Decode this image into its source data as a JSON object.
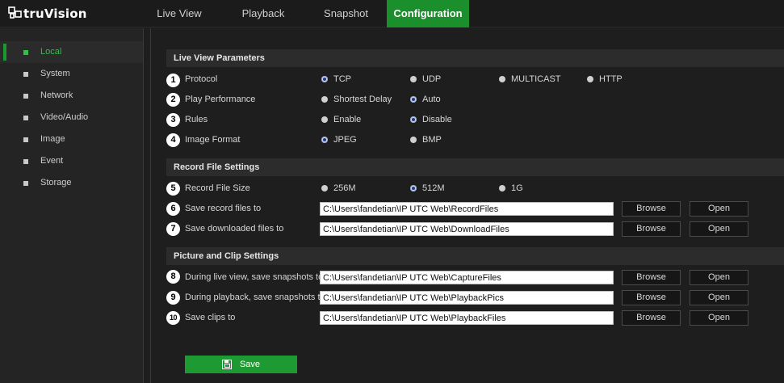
{
  "app": {
    "logo_text": "truVision",
    "logo_icon": "truvision-logo-icon"
  },
  "nav": {
    "tabs": [
      {
        "label": "Live View",
        "active": false
      },
      {
        "label": "Playback",
        "active": false
      },
      {
        "label": "Snapshot",
        "active": false
      },
      {
        "label": "Configuration",
        "active": true
      }
    ]
  },
  "sidebar": {
    "items": [
      {
        "label": "Local",
        "active": true
      },
      {
        "label": "System",
        "active": false
      },
      {
        "label": "Network",
        "active": false
      },
      {
        "label": "Video/Audio",
        "active": false
      },
      {
        "label": "Image",
        "active": false
      },
      {
        "label": "Event",
        "active": false
      },
      {
        "label": "Storage",
        "active": false
      }
    ]
  },
  "sections": {
    "live_view": "Live View Parameters",
    "record_file": "Record File Settings",
    "picture_clip": "Picture and Clip Settings"
  },
  "callouts": [
    "1",
    "2",
    "3",
    "4",
    "5",
    "6",
    "7",
    "8",
    "9",
    "10"
  ],
  "live_view": {
    "protocol": {
      "label": "Protocol",
      "options": [
        "TCP",
        "UDP",
        "MULTICAST",
        "HTTP"
      ],
      "selected": "TCP"
    },
    "play_performance": {
      "label": "Play Performance",
      "options": [
        "Shortest Delay",
        "Auto"
      ],
      "selected": "Auto"
    },
    "rules": {
      "label": "Rules",
      "options": [
        "Enable",
        "Disable"
      ],
      "selected": "Disable"
    },
    "image_format": {
      "label": "Image Format",
      "options": [
        "JPEG",
        "BMP"
      ],
      "selected": "JPEG"
    }
  },
  "record_file": {
    "size": {
      "label": "Record File Size",
      "options": [
        "256M",
        "512M",
        "1G"
      ],
      "selected": "512M"
    },
    "save_record": {
      "label": "Save record files to",
      "value": "C:\\Users\\fandetian\\IP UTC Web\\RecordFiles"
    },
    "save_downloaded": {
      "label": "Save downloaded files to",
      "value": "C:\\Users\\fandetian\\IP UTC Web\\DownloadFiles"
    }
  },
  "picture_clip": {
    "live_snapshots": {
      "label": "During live view, save snapshots to",
      "value": "C:\\Users\\fandetian\\IP UTC Web\\CaptureFiles"
    },
    "playback_snapshots": {
      "label": "During playback, save snapshots to",
      "value": "C:\\Users\\fandetian\\IP UTC Web\\PlaybackPics"
    },
    "clips": {
      "label": "Save clips to",
      "value": "C:\\Users\\fandetian\\IP UTC Web\\PlaybackFiles"
    }
  },
  "buttons": {
    "browse": "Browse",
    "open": "Open",
    "save": "Save"
  },
  "colors": {
    "accent": "#1a8f2b",
    "active_text": "#2fc046",
    "background": "#1e1e1e"
  }
}
